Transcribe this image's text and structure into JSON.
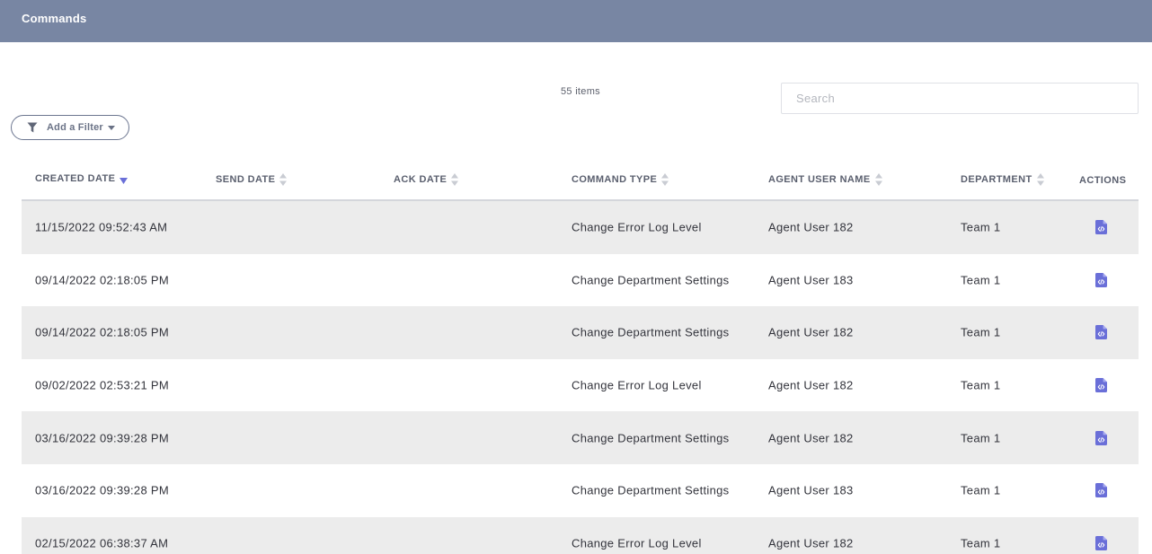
{
  "header": {
    "title": "Commands"
  },
  "toolbar": {
    "item_count": "55 items",
    "search_placeholder": "Search",
    "filter_label": "Add a Filter"
  },
  "table": {
    "columns": [
      "CREATED DATE",
      "SEND DATE",
      "ACK DATE",
      "COMMAND TYPE",
      "AGENT USER NAME",
      "DEPARTMENT",
      "ACTIONS"
    ],
    "sorted_column": "CREATED DATE",
    "sort_direction": "descending",
    "rows": [
      {
        "created": "11/15/2022 09:52:43 AM",
        "send": "",
        "ack": "",
        "type": "Change Error Log Level",
        "agent": "Agent User 182",
        "dept": "Team 1"
      },
      {
        "created": "09/14/2022 02:18:05 PM",
        "send": "",
        "ack": "",
        "type": "Change Department Settings",
        "agent": "Agent User 183",
        "dept": "Team 1"
      },
      {
        "created": "09/14/2022 02:18:05 PM",
        "send": "",
        "ack": "",
        "type": "Change Department Settings",
        "agent": "Agent User 182",
        "dept": "Team 1"
      },
      {
        "created": "09/02/2022 02:53:21 PM",
        "send": "",
        "ack": "",
        "type": "Change Error Log Level",
        "agent": "Agent User 182",
        "dept": "Team 1"
      },
      {
        "created": "03/16/2022 09:39:28 PM",
        "send": "",
        "ack": "",
        "type": "Change Department Settings",
        "agent": "Agent User 182",
        "dept": "Team 1"
      },
      {
        "created": "03/16/2022 09:39:28 PM",
        "send": "",
        "ack": "",
        "type": "Change Department Settings",
        "agent": "Agent User 183",
        "dept": "Team 1"
      },
      {
        "created": "02/15/2022 06:38:37 AM",
        "send": "",
        "ack": "",
        "type": "Change Error Log Level",
        "agent": "Agent User 182",
        "dept": "Team 1"
      }
    ]
  },
  "icons": {
    "filter": "filter-icon",
    "caret": "caret-down-icon",
    "sort": "sort-icon",
    "sort_active": "sort-down-icon",
    "action": "code-file-icon"
  },
  "colors": {
    "header_bg": "#7886a3",
    "accent": "#6a6fd8",
    "row_shade": "#ececec"
  }
}
